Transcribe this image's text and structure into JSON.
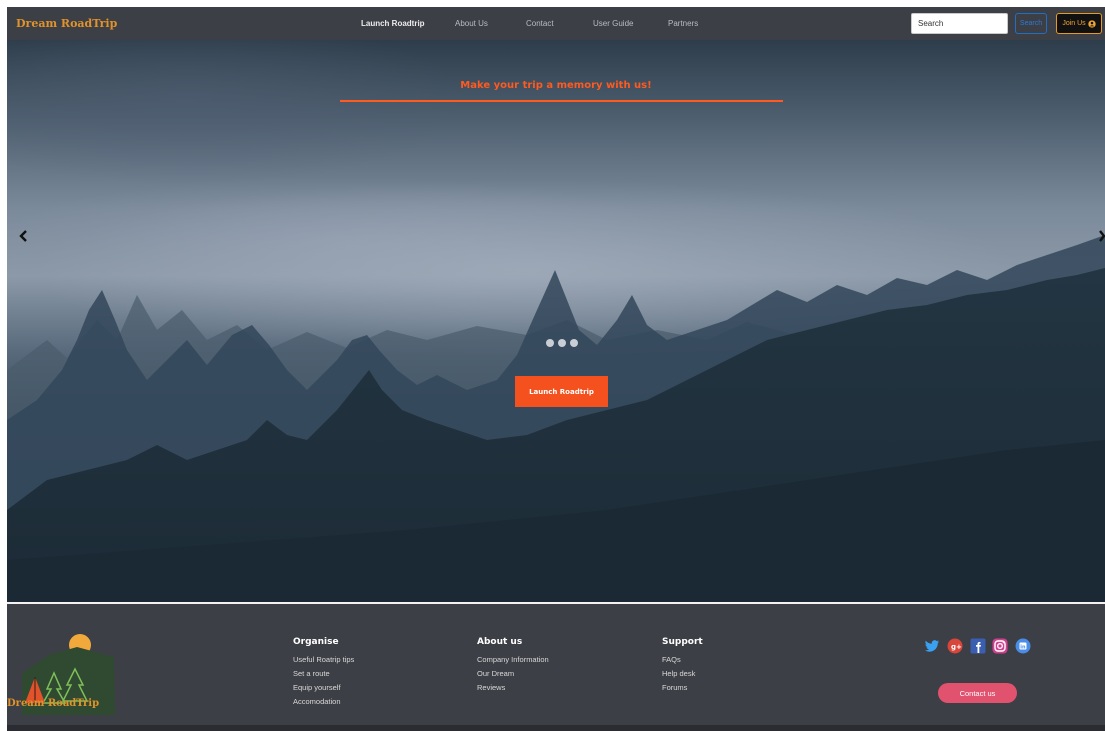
{
  "navbar": {
    "brand": "Dream RoadTrip",
    "links": [
      {
        "label": "Launch Roadtrip",
        "active": true
      },
      {
        "label": "About Us"
      },
      {
        "label": "Contact"
      },
      {
        "label": "User Guide"
      },
      {
        "label": "Partners"
      }
    ],
    "search": {
      "placeholder": "Search",
      "button_label": "Search"
    },
    "join_label": "Join Us",
    "colors": {
      "bg": "#3d3f46",
      "brand": "#e0932b",
      "join_border": "#e69a20",
      "search_btn": "#1f6fc2"
    }
  },
  "hero": {
    "tagline": "Make your trip a memory with us!",
    "cta_label": "Launch Roadtrip",
    "carousel": {
      "prev_icon": "chevron-left-icon",
      "next_icon": "chevron-right-icon",
      "slide_count": 3
    },
    "colors": {
      "accent": "#ff5a1f",
      "cta": "#f4511e"
    }
  },
  "footer": {
    "logo_text": "Dream RoadTrip",
    "columns": [
      {
        "title": "Organise",
        "links": [
          "Useful Roatrip tips",
          "Set a route",
          "Equip yourself",
          "Accomodation"
        ]
      },
      {
        "title": "About us",
        "links": [
          "Company Information",
          "Our Dream",
          "Reviews"
        ]
      },
      {
        "title": "Support",
        "links": [
          "FAQs",
          "Help desk",
          "Forums"
        ]
      }
    ],
    "social_icons": [
      "twitter-icon",
      "google-plus-icon",
      "facebook-icon",
      "instagram-icon",
      "linkedin-icon"
    ],
    "contact_label": "Contact us",
    "colors": {
      "bg": "#3d3f46",
      "contact_btn": "#e1526f"
    }
  }
}
